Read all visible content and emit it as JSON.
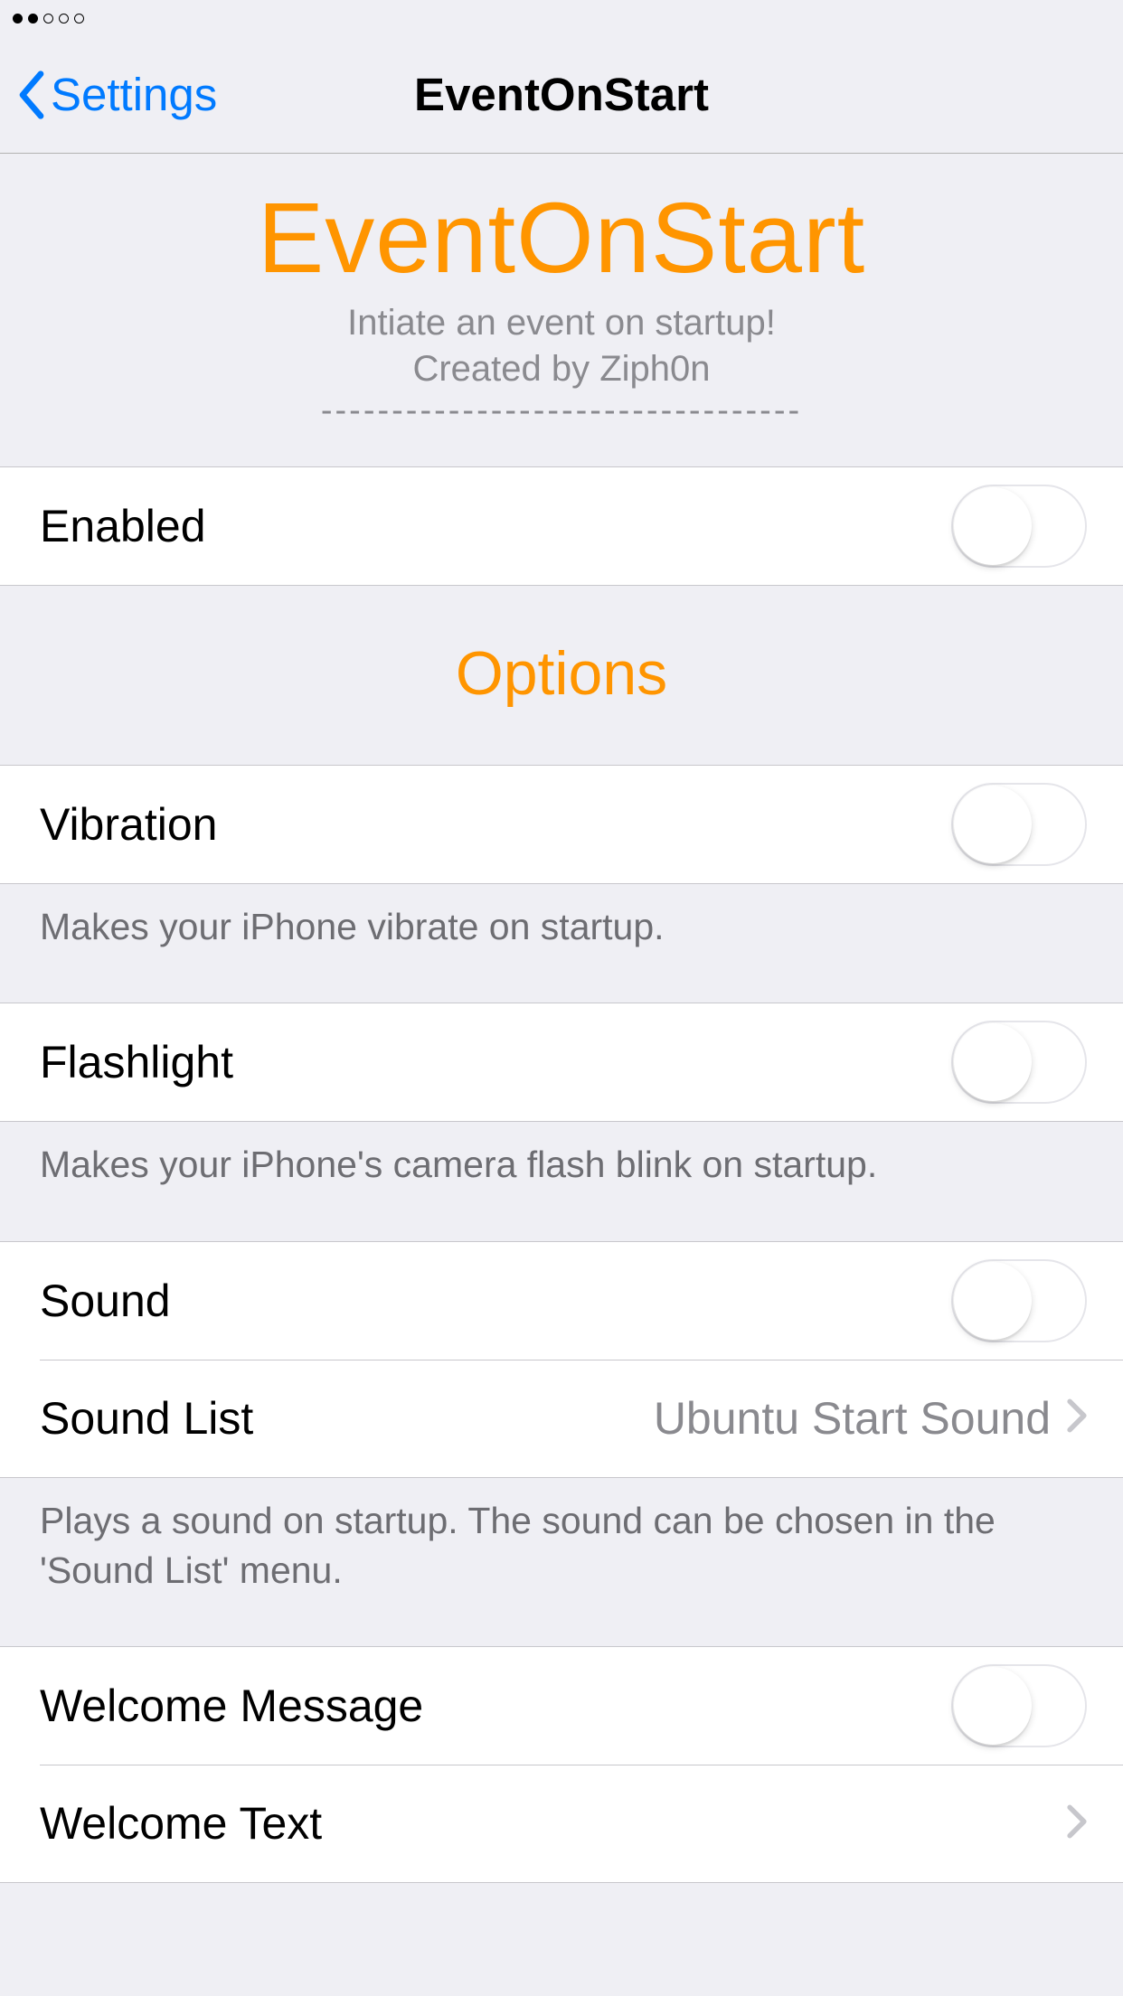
{
  "nav": {
    "back_label": "Settings",
    "title": "EventOnStart"
  },
  "header": {
    "app_title": "EventOnStart",
    "subtitle": "Intiate an event on startup!",
    "author": "Created by Ziph0n",
    "divider": "----------------------------------"
  },
  "enabled": {
    "label": "Enabled"
  },
  "options": {
    "section_title": "Options",
    "vibration": {
      "label": "Vibration",
      "footer": "Makes your iPhone vibrate on startup."
    },
    "flashlight": {
      "label": "Flashlight",
      "footer": "Makes your iPhone's camera flash blink on startup."
    },
    "sound": {
      "label": "Sound",
      "list_label": "Sound List",
      "list_value": "Ubuntu Start Sound",
      "footer": "Plays a sound on startup. The sound can be chosen in the 'Sound List' menu."
    },
    "welcome": {
      "message_label": "Welcome Message",
      "text_label": "Welcome Text"
    }
  }
}
